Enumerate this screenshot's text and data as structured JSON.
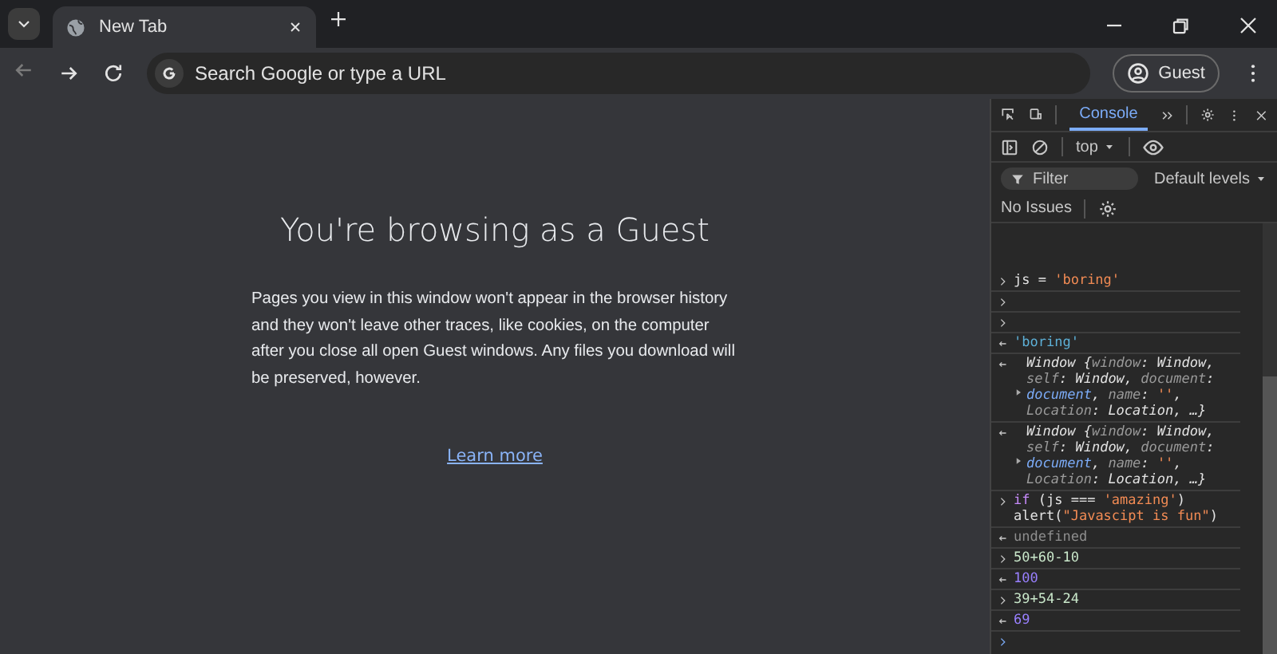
{
  "browser": {
    "tabs": [
      {
        "title": "New Tab",
        "selected": true
      }
    ],
    "address": {
      "placeholder": "Search Google or type a URL"
    },
    "profile": "Guest"
  },
  "page": {
    "heading": "You're browsing as a Guest",
    "body": "Pages you view in this window won't appear in the browser history and they won't leave other traces, like cookies, on the computer after you close all open Guest windows. Any files you download will be preserved, however.",
    "link": "Learn more"
  },
  "devtools": {
    "tabs": [
      {
        "label": "Console",
        "selected": true
      }
    ],
    "context": "top",
    "filter": {
      "placeholder": "Filter"
    },
    "levels": "Default levels",
    "issues": "No Issues",
    "console": [
      {
        "kind": "input",
        "tokens": [
          {
            "text": "js = ",
            "kind": "plain"
          },
          {
            "text": "'boring'",
            "kind": "string"
          }
        ]
      },
      {
        "kind": "input"
      },
      {
        "kind": "input"
      },
      {
        "kind": "output",
        "tokens": [
          {
            "text": "'boring'",
            "kind": "result"
          }
        ]
      },
      {
        "kind": "object",
        "tokens": [
          {
            "text": "Window {",
            "kind": "italic"
          },
          {
            "text": "window",
            "kind": "key"
          },
          {
            "text": ": Window, ",
            "kind": "italic"
          },
          {
            "text": "self",
            "kind": "key"
          },
          {
            "text": ": Window, ",
            "kind": "italic"
          },
          {
            "text": "document",
            "kind": "key"
          },
          {
            "text": ": ",
            "kind": "italic"
          },
          {
            "text": "document",
            "kind": "link"
          },
          {
            "text": ", ",
            "kind": "italic"
          },
          {
            "text": "name",
            "kind": "key"
          },
          {
            "text": ": ",
            "kind": "italic"
          },
          {
            "text": "''",
            "kind": "string"
          },
          {
            "text": ", ",
            "kind": "italic"
          },
          {
            "text": "Location",
            "kind": "key"
          },
          {
            "text": ": Location, …}",
            "kind": "italic"
          }
        ]
      },
      {
        "kind": "object",
        "tokens": [
          {
            "text": "Window {",
            "kind": "italic"
          },
          {
            "text": "window",
            "kind": "key"
          },
          {
            "text": ": Window, ",
            "kind": "italic"
          },
          {
            "text": "self",
            "kind": "key"
          },
          {
            "text": ": Window, ",
            "kind": "italic"
          },
          {
            "text": "document",
            "kind": "key"
          },
          {
            "text": ": ",
            "kind": "italic"
          },
          {
            "text": "document",
            "kind": "link"
          },
          {
            "text": ", ",
            "kind": "italic"
          },
          {
            "text": "name",
            "kind": "key"
          },
          {
            "text": ": ",
            "kind": "italic"
          },
          {
            "text": "''",
            "kind": "string"
          },
          {
            "text": ", ",
            "kind": "italic"
          },
          {
            "text": "Location",
            "kind": "key"
          },
          {
            "text": ": Location, …}",
            "kind": "italic"
          }
        ]
      },
      {
        "kind": "input",
        "tokens": [
          {
            "text": "if",
            "kind": "keyword"
          },
          {
            "text": " (js === ",
            "kind": "plain"
          },
          {
            "text": "'amazing'",
            "kind": "string"
          },
          {
            "text": ")\nalert(",
            "kind": "plain"
          },
          {
            "text": "\"Javascipt is fun\"",
            "kind": "string"
          },
          {
            "text": ")",
            "kind": "plain"
          }
        ]
      },
      {
        "kind": "output",
        "tokens": [
          {
            "text": "undefined",
            "kind": "undefined"
          }
        ]
      },
      {
        "kind": "input",
        "tokens": [
          {
            "text": "50+60-10",
            "kind": "expr"
          }
        ]
      },
      {
        "kind": "output",
        "tokens": [
          {
            "text": "100",
            "kind": "number"
          }
        ]
      },
      {
        "kind": "input",
        "tokens": [
          {
            "text": "39+54-24",
            "kind": "expr"
          }
        ]
      },
      {
        "kind": "output",
        "tokens": [
          {
            "text": "69",
            "kind": "number"
          }
        ]
      }
    ]
  }
}
